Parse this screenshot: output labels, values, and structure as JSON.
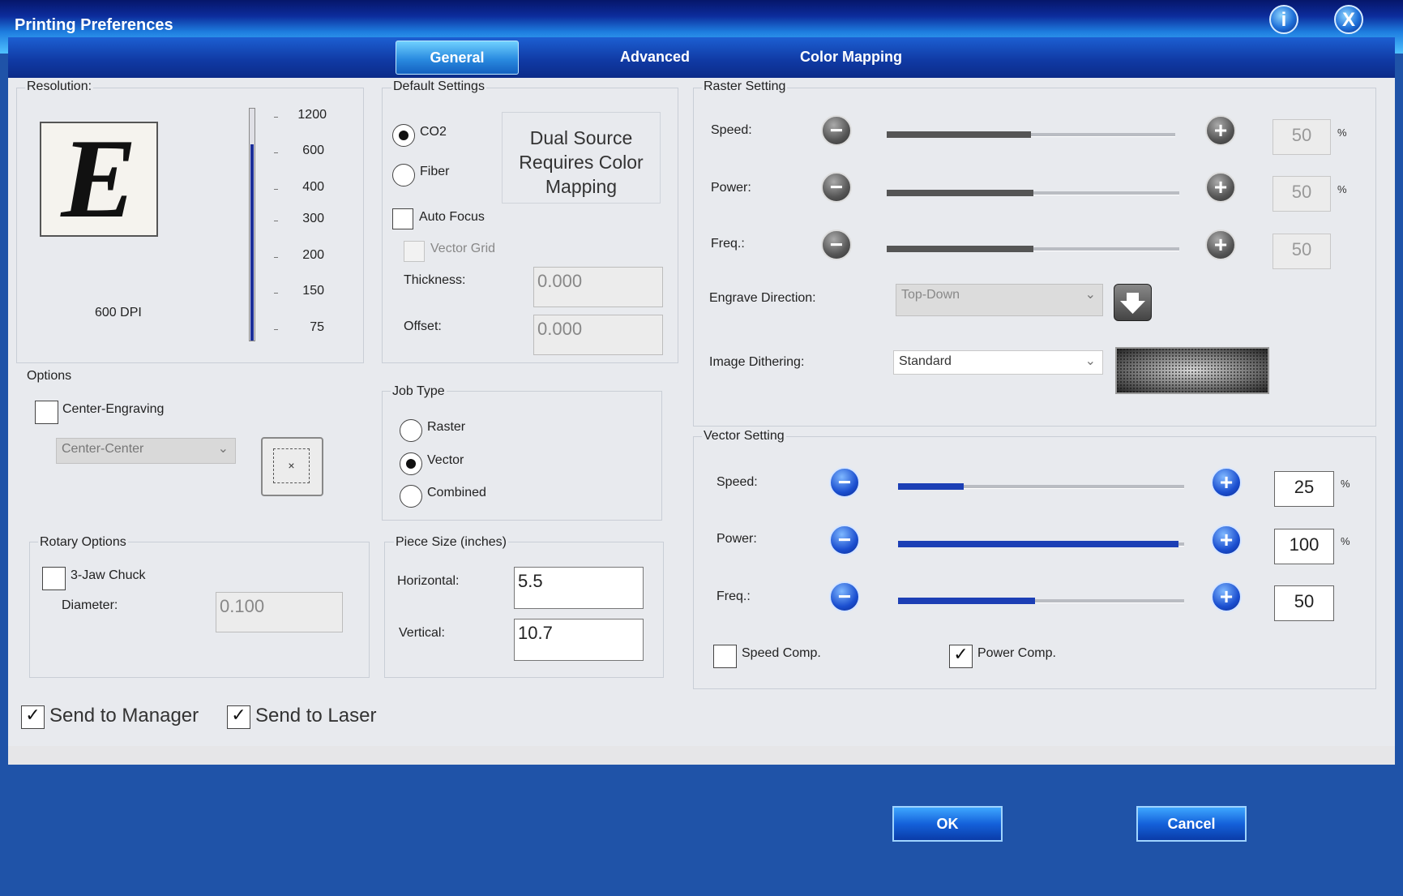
{
  "window": {
    "title": "Printing Preferences",
    "info_icon": "i",
    "close_icon": "X"
  },
  "tabs": [
    {
      "label": "General",
      "active": true
    },
    {
      "label": "Advanced",
      "active": false
    },
    {
      "label": "Color Mapping",
      "active": false
    }
  ],
  "resolution": {
    "label": "Resolution:",
    "preview_letter": "E",
    "dpi_text": "600 DPI",
    "ticks": [
      "1200",
      "600",
      "400",
      "300",
      "200",
      "150",
      "75"
    ],
    "selected": "600"
  },
  "default_settings": {
    "label": "Default Settings",
    "co2": "CO2",
    "fiber": "Fiber",
    "selected": "CO2",
    "dual_source_note": "Dual Source Requires Color Mapping",
    "auto_focus": "Auto Focus",
    "vector_grid": "Vector Grid",
    "thickness_label": "Thickness:",
    "thickness_value": "0.000",
    "offset_label": "Offset:",
    "offset_value": "0.000"
  },
  "options": {
    "label": "Options",
    "center_engraving": "Center-Engraving",
    "center_select": "Center-Center"
  },
  "job_type": {
    "label": "Job Type",
    "raster": "Raster",
    "vector": "Vector",
    "combined": "Combined",
    "selected": "Vector"
  },
  "rotary": {
    "label": "Rotary Options",
    "jaw_chuck": "3-Jaw Chuck",
    "diameter_label": "Diameter:",
    "diameter_value": "0.100"
  },
  "piece_size": {
    "label": "Piece Size (inches)",
    "horizontal_label": "Horizontal:",
    "horizontal_value": "5.5",
    "vertical_label": "Vertical:",
    "vertical_value": "10.7"
  },
  "raster": {
    "label": "Raster Setting",
    "speed_label": "Speed:",
    "speed_value": "50",
    "speed_unit": "%",
    "power_label": "Power:",
    "power_value": "50",
    "power_unit": "%",
    "freq_label": "Freq.:",
    "freq_value": "50",
    "engrave_direction_label": "Engrave Direction:",
    "engrave_direction_value": "Top-Down",
    "image_dithering_label": "Image Dithering:",
    "image_dithering_value": "Standard"
  },
  "vector": {
    "label": "Vector Setting",
    "speed_label": "Speed:",
    "speed_value": "25",
    "speed_unit": "%",
    "power_label": "Power:",
    "power_value": "100",
    "power_unit": "%",
    "freq_label": "Freq.:",
    "freq_value": "50",
    "speed_comp": "Speed Comp.",
    "power_comp": "Power Comp."
  },
  "send": {
    "to_manager": "Send to Manager",
    "to_laser": "Send to Laser"
  },
  "buttons": {
    "ok": "OK",
    "cancel": "Cancel"
  },
  "checkbox_mark": "✓",
  "plus": "+",
  "minus": "−"
}
